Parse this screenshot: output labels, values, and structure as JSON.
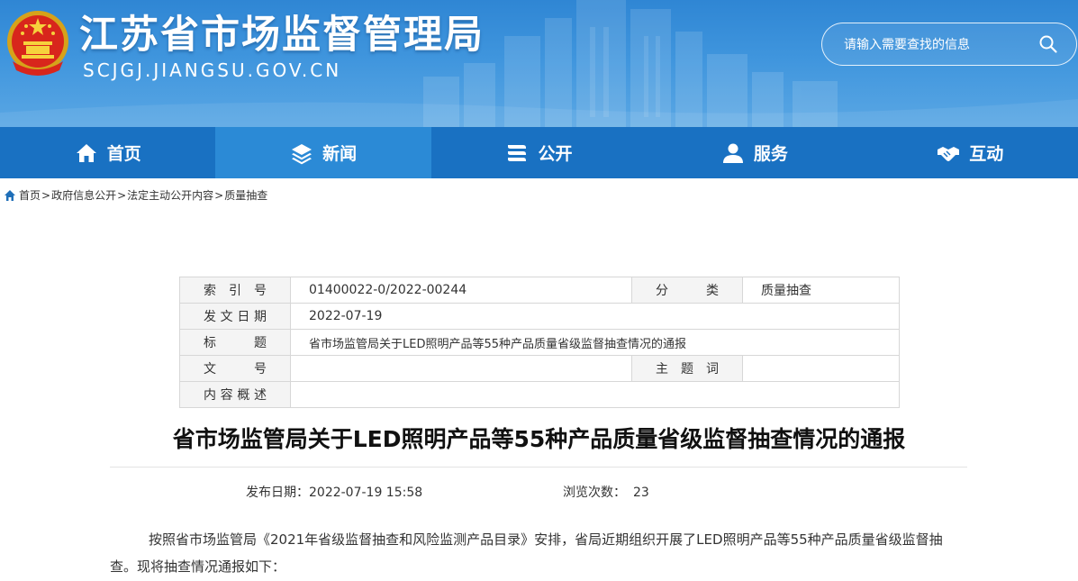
{
  "header": {
    "title": "江苏省市场监督管理局",
    "domain": "SCJGJ.JIANGSU.GOV.CN",
    "search_placeholder": "请输入需要查找的信息"
  },
  "nav": {
    "items": [
      {
        "label": "首页",
        "icon": "home-icon"
      },
      {
        "label": "新闻",
        "icon": "layers-icon",
        "active": true
      },
      {
        "label": "公开",
        "icon": "books-icon"
      },
      {
        "label": "服务",
        "icon": "user-icon"
      },
      {
        "label": "互动",
        "icon": "handshake-icon"
      }
    ]
  },
  "breadcrumb": [
    "首页",
    "政府信息公开",
    "法定主动公开内容",
    "质量抽查"
  ],
  "info": {
    "index_label": "索引号",
    "index_value": "01400022-0/2022-00244",
    "category_label": "分类",
    "category_value": "质量抽查",
    "date_label": "发文日期",
    "date_value": "2022-07-19",
    "title_label": "标题",
    "title_value": "省市场监管局关于LED照明产品等55种产品质量省级监督抽查情况的通报",
    "docno_label": "文号",
    "docno_value": "",
    "keywords_label": "主题词",
    "keywords_value": "",
    "summary_label": "内容概述",
    "summary_value": ""
  },
  "article": {
    "title": "省市场监管局关于LED照明产品等55种产品质量省级监督抽查情况的通报",
    "publish_label": "发布日期：",
    "publish_value": "2022-07-19 15:58",
    "views_label": "浏览次数：",
    "views_value": "23",
    "body": "按照省市场监管局《2021年省级监督抽查和风险监测产品目录》安排，省局近期组织开展了LED照明产品等55种产品质量省级监督抽查。现将抽查情况通报如下："
  },
  "colors": {
    "nav_bg": "#1971c2",
    "nav_active": "#2b8ad6",
    "header_bg": "#3f95dd"
  }
}
